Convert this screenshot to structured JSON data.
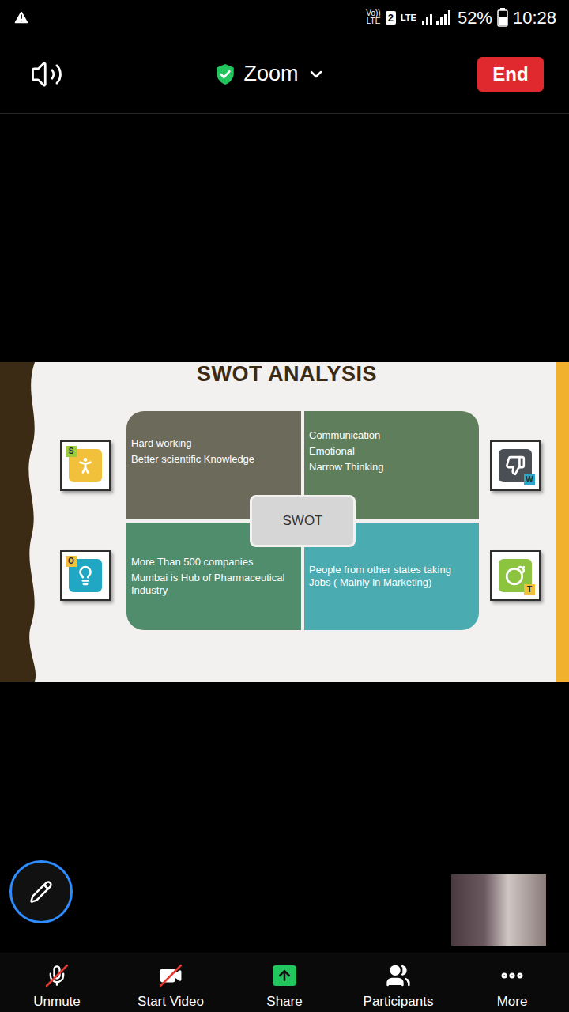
{
  "status_bar": {
    "volte_top": "Vo))",
    "volte_bottom": "LTE",
    "sim": "2",
    "data": "LTE",
    "battery": "52%",
    "time": "10:28"
  },
  "header": {
    "title": "Zoom",
    "end_button": "End"
  },
  "slide": {
    "title": "SWOT ANALYSIS",
    "center": "SWOT",
    "quadrants": [
      {
        "letter": "S",
        "lines": [
          "Hard working",
          "Better scientific Knowledge"
        ],
        "color": "#6b6a5b",
        "icon_color": "#f2c13b",
        "badge_color": "#9ccc3b"
      },
      {
        "letter": "W",
        "lines": [
          "Communication",
          "Emotional",
          "Narrow Thinking"
        ],
        "color": "#5f7f5c",
        "icon_color": "#4a4f55",
        "badge_color": "#2aa7c9"
      },
      {
        "letter": "O",
        "lines": [
          "More Than 500 companies",
          "Mumbai is Hub of Pharmaceutical Industry"
        ],
        "color": "#4f8d6c",
        "icon_color": "#1fa7c4",
        "badge_color": "#f2c13b"
      },
      {
        "letter": "T",
        "lines": [
          "People from other states taking Jobs ( Mainly in Marketing)"
        ],
        "color": "#4aabb1",
        "icon_color": "#8cc43f",
        "badge_color": "#f2c13b"
      }
    ]
  },
  "toolbar": [
    {
      "label": "Unmute",
      "kind": "mic",
      "off": true,
      "selected": false
    },
    {
      "label": "Start Video",
      "kind": "video",
      "off": true,
      "selected": false
    },
    {
      "label": "Share",
      "kind": "share",
      "off": false,
      "selected": true
    },
    {
      "label": "Participants",
      "kind": "participants",
      "off": false,
      "selected": false
    },
    {
      "label": "More",
      "kind": "more",
      "off": false,
      "selected": false
    }
  ]
}
